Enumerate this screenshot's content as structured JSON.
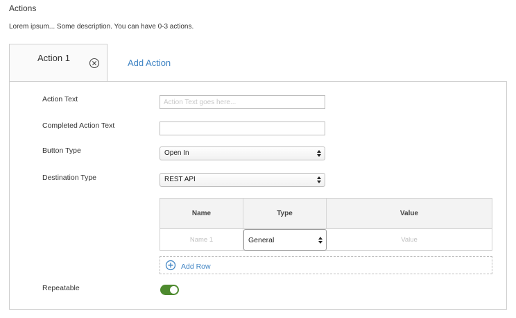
{
  "section": {
    "title": "Actions",
    "description": "Lorem ipsum... Some description. You can have 0-3 actions."
  },
  "tabs": {
    "active_label": "Action 1",
    "add_label": "Add Action"
  },
  "form": {
    "action_text": {
      "label": "Action Text",
      "value": "",
      "placeholder": "Action Text goes here..."
    },
    "completed_action_text": {
      "label": "Completed Action Text",
      "value": ""
    },
    "button_type": {
      "label": "Button Type",
      "value": "Open In"
    },
    "destination_type": {
      "label": "Destination Type",
      "value": "REST API"
    },
    "table": {
      "headers": [
        "Name",
        "Type",
        "Value"
      ],
      "rows": [
        {
          "name_placeholder": "Name 1",
          "type": "General",
          "value_placeholder": "Value"
        }
      ]
    },
    "add_row_label": "Add Row",
    "repeatable": {
      "label": "Repeatable",
      "enabled": true
    }
  },
  "colors": {
    "accent": "#3f84c4",
    "toggle_on": "#4d8a2e",
    "border": "#cfcfcf"
  },
  "icons": [
    "close-icon",
    "plus-circle-icon",
    "select-arrows-icon"
  ]
}
